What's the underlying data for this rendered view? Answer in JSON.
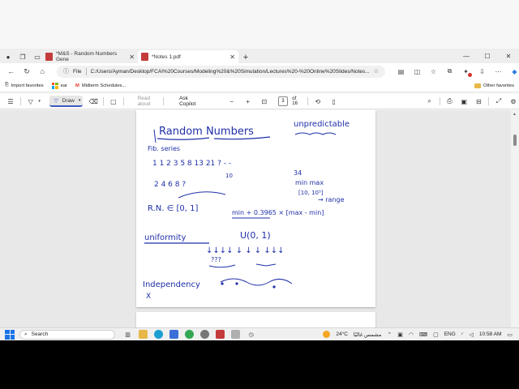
{
  "browser": {
    "tabs": [
      {
        "label": "*M&S - Random Numbers Gene",
        "active": false
      },
      {
        "label": "*Notes 1.pdf",
        "active": true
      }
    ],
    "address": {
      "scheme_label": "File",
      "url": "C:/Users/Ayman/Desktop/FCAI%20Courses/Modeling%20&%20Simulation/Lectures%20-%20Online%20Slides/Notes..."
    },
    "favorites": {
      "import_label": "Import favorites",
      "items": [
        "ear",
        "Midterm Schedules..."
      ],
      "other_label": "Other favorites"
    }
  },
  "pdf_toolbar": {
    "draw_label": "Draw",
    "read_aloud_label": "Read aloud",
    "ask_copilot_label": "Ask Copilot",
    "current_page": "3",
    "total_pages": "of 16"
  },
  "notes": {
    "title": "Random Numbers",
    "unpredictable": "unpredictable",
    "fib_series": "Fib. series",
    "fib_row": "1 1 2 3 5 8 13 21 ? - -",
    "small_ten": "10",
    "thirty_four": "34",
    "even_row": "2 4 6 8 ?",
    "min_max": "min   max",
    "range_interval": "[10, 10⁵]",
    "range_label": "→ range",
    "rn_in": "R.N. ∈ [0, 1]",
    "formula": "min + 0.3965 × [max - min]",
    "uniformity": "uniformity",
    "uniform_dist": "U(0, 1)",
    "arrows_row": "↓↓↓↓  ↓ ↓ ↓ ↓↓↓",
    "question_marks": "???",
    "independency": "Independency",
    "cross": "X"
  },
  "taskbar": {
    "search_label": "Search",
    "weather": "24°C",
    "weather_text": "مشمس غالبًا",
    "language": "ENG",
    "time": "10:58 AM"
  },
  "colors": {
    "ink": "#1f2fa8",
    "accent": "#3b5bbf"
  }
}
